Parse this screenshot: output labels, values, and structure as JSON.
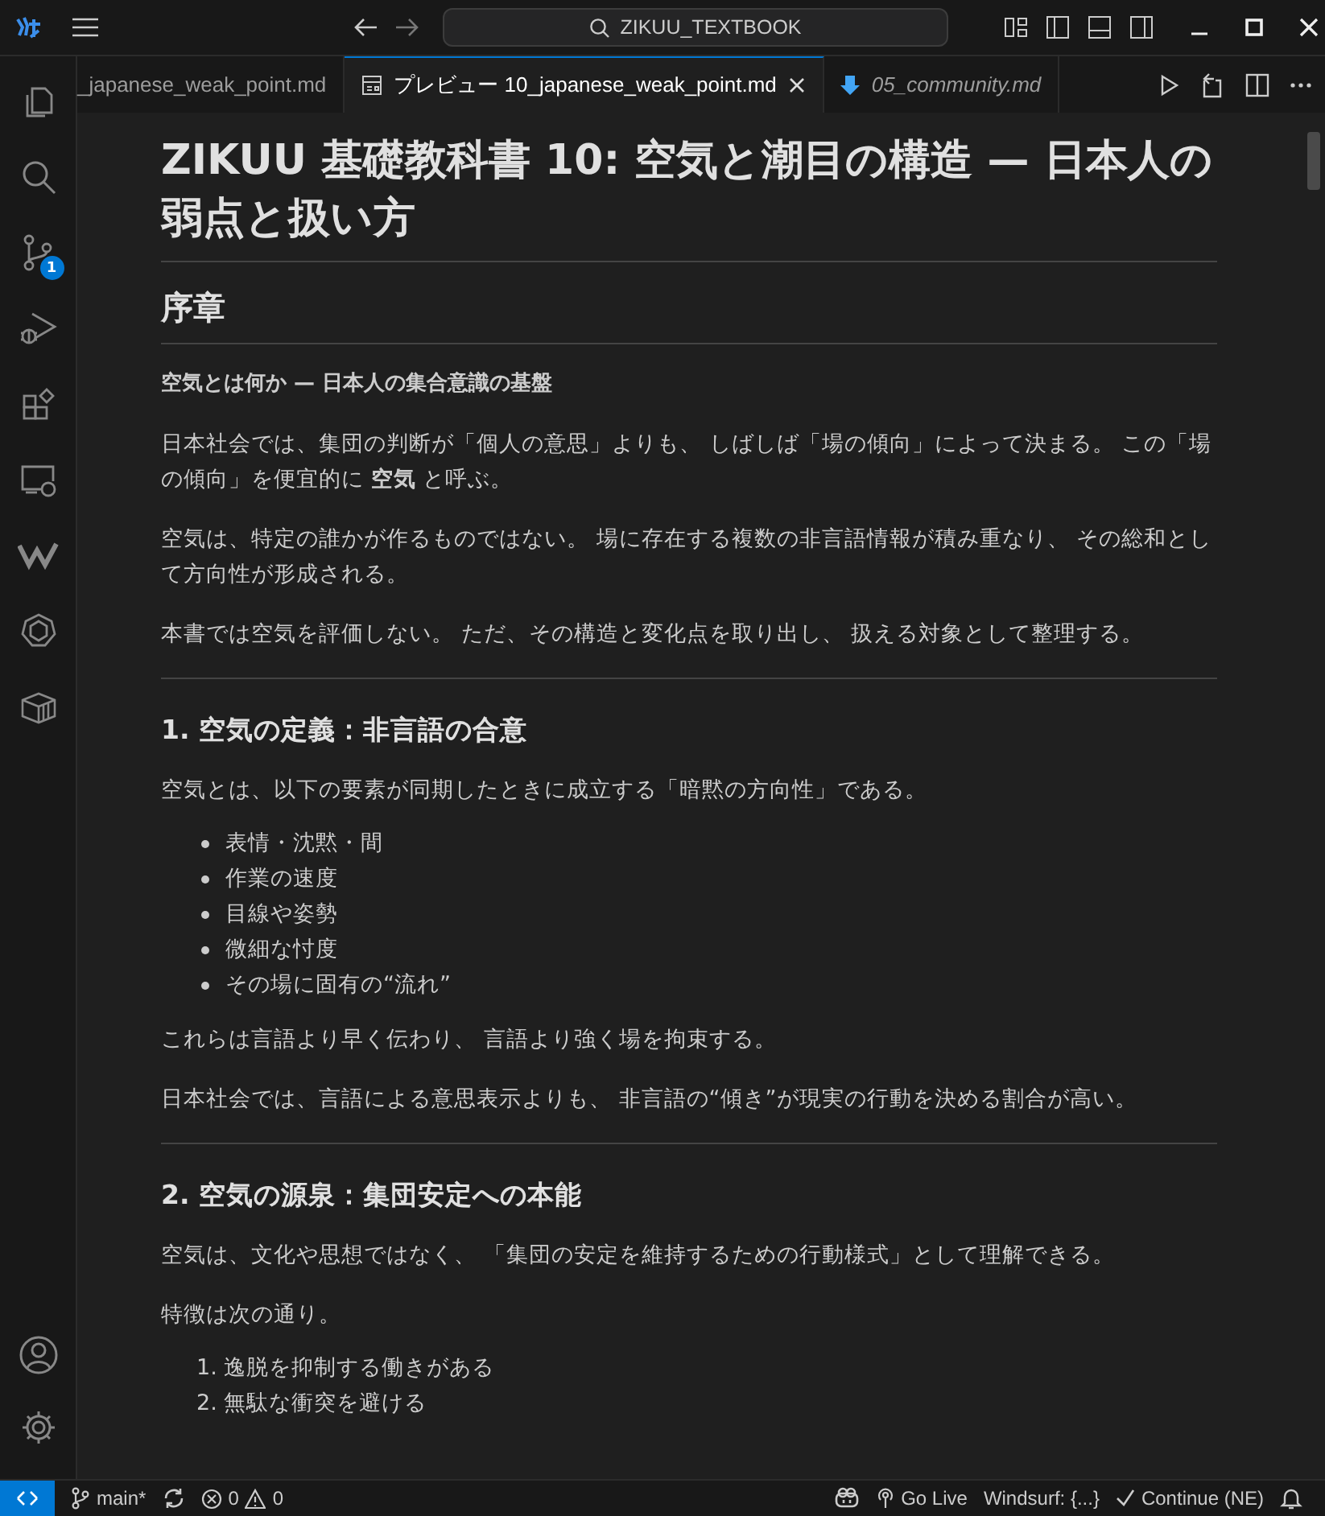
{
  "title_bar": {
    "search": "ZIKUU_TEXTBOOK"
  },
  "activity_bar": [
    {
      "kind": "files",
      "selected": false
    },
    {
      "kind": "search",
      "selected": false
    },
    {
      "kind": "source-control",
      "selected": false,
      "badge": "1"
    },
    {
      "kind": "run-debug",
      "selected": false
    },
    {
      "kind": "extensions",
      "selected": false
    },
    {
      "kind": "remote",
      "selected": false
    },
    {
      "kind": "windsurf",
      "selected": false
    },
    {
      "kind": "ring",
      "selected": false
    },
    {
      "kind": "container",
      "selected": false
    }
  ],
  "tabs": [
    {
      "label": "_japanese_weak_point.md",
      "kind": "file",
      "selected": false,
      "italic": false
    },
    {
      "label": "プレビュー 10_japanese_weak_point.md",
      "kind": "preview",
      "selected": true,
      "italic": false
    },
    {
      "label": "05_community.md",
      "kind": "markdown",
      "selected": false,
      "italic": true
    }
  ],
  "content": [
    {
      "kind": "h1",
      "text": "ZIKUU 基礎教科書 10: 空気と潮目の構造 — 日本人の弱点と扱い方"
    },
    {
      "kind": "h2",
      "text": "序章"
    },
    {
      "kind": "bold",
      "text": "空気とは何か — 日本人の集合意識の基盤"
    },
    {
      "kind": "p",
      "text": "日本社会では、集団の判断が「個人の意思」よりも、 しばしば「場の傾向」によって決まる。 この「場の傾向」を便宜的に **空気** と呼ぶ。"
    },
    {
      "kind": "p",
      "text": "空気は、特定の誰かが作るものではない。 場に存在する複数の非言語情報が積み重なり、 その総和として方向性が形成される。"
    },
    {
      "kind": "p",
      "text": "本書では空気を評価しない。 ただ、その構造と変化点を取り出し、 扱える対象として整理する。"
    },
    {
      "kind": "hr"
    },
    {
      "kind": "h3",
      "text": "1. 空気の定義：非言語の合意"
    },
    {
      "kind": "p",
      "text": "空気とは、以下の要素が同期したときに成立する「暗黙の方向性」である。"
    },
    {
      "kind": "ul",
      "items": [
        "表情・沈黙・間",
        "作業の速度",
        "目線や姿勢",
        "微細な忖度",
        "その場に固有の“流れ”"
      ]
    },
    {
      "kind": "p",
      "text": "これらは言語より早く伝わり、 言語より強く場を拘束する。"
    },
    {
      "kind": "p",
      "text": "日本社会では、言語による意思表示よりも、 非言語の“傾き”が現実の行動を決める割合が高い。"
    },
    {
      "kind": "hr"
    },
    {
      "kind": "h3",
      "text": "2. 空気の源泉：集団安定への本能"
    },
    {
      "kind": "p",
      "text": "空気は、文化や思想ではなく、 「集団の安定を維持するための行動様式」として理解できる。"
    },
    {
      "kind": "p",
      "text": "特徴は次の通り。"
    },
    {
      "kind": "ol",
      "items": [
        {
          "num": "1.",
          "text": "逸脱を抑制する働きがある"
        },
        {
          "num": "2.",
          "text": "無駄な衝突を避ける"
        }
      ]
    }
  ],
  "status_bar": {
    "branch": "main*",
    "errors": "0",
    "warnings": "0",
    "items": [
      {
        "kind": "copilot"
      },
      {
        "kind": "broadcast",
        "text": "Go Live"
      },
      {
        "kind": "plain",
        "text": "Windsurf: {...}"
      },
      {
        "kind": "check",
        "text": "Continue (NE)"
      },
      {
        "kind": "bell"
      }
    ]
  }
}
